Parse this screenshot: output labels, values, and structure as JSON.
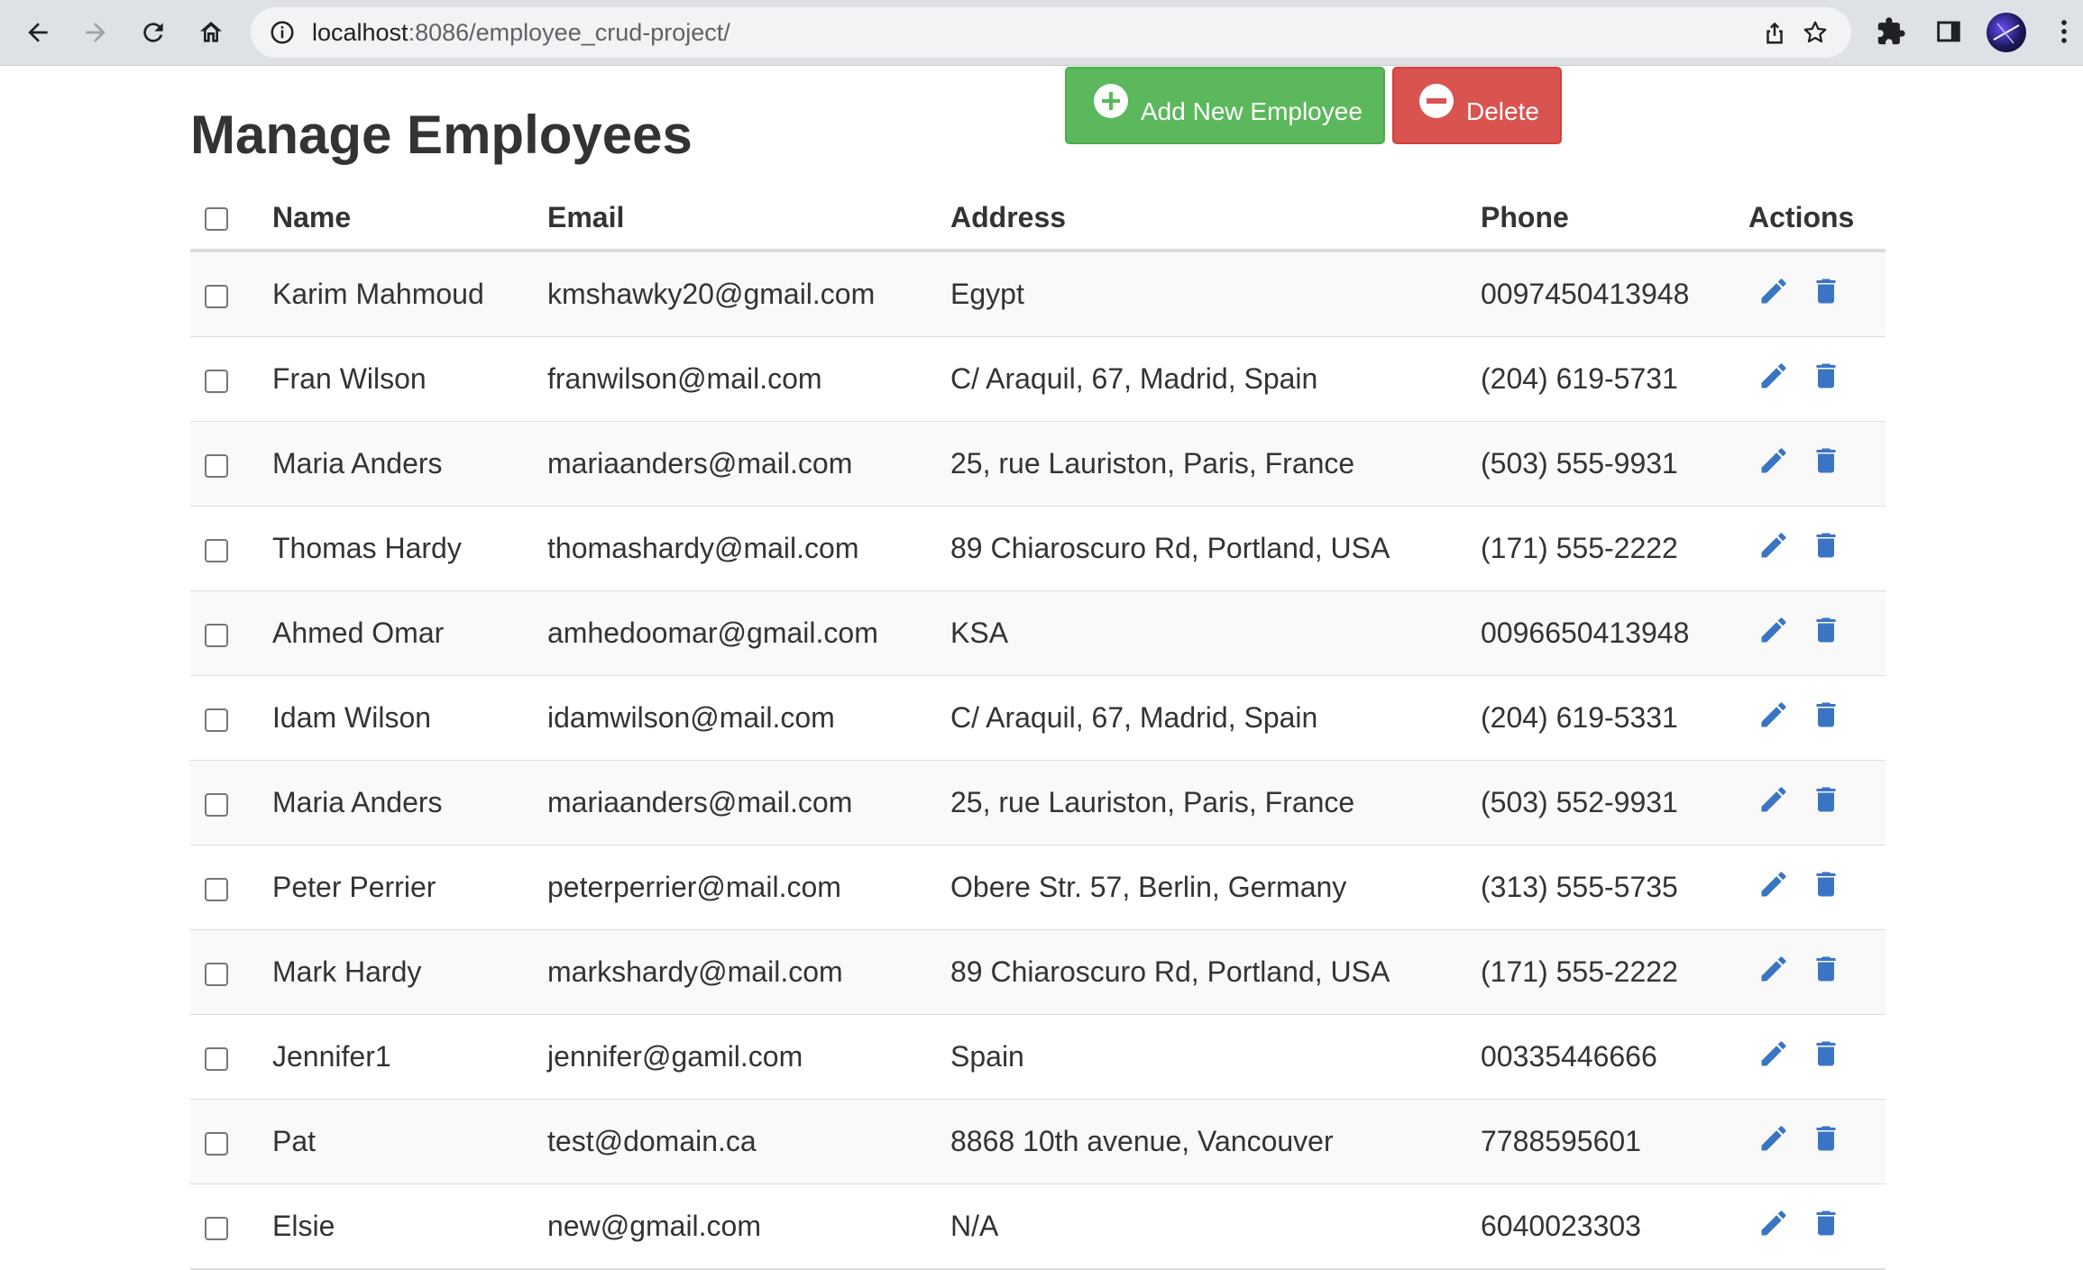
{
  "browser": {
    "url_host": "localhost",
    "url_rest": ":8086/employee_crud-project/"
  },
  "page": {
    "title": "Manage Employees",
    "add_button_label": "Add New Employee",
    "delete_button_label": "Delete"
  },
  "table": {
    "headers": {
      "name": "Name",
      "email": "Email",
      "address": "Address",
      "phone": "Phone",
      "actions": "Actions"
    },
    "rows": [
      {
        "name": "Karim Mahmoud",
        "email": "kmshawky20@gmail.com",
        "address": "Egypt",
        "phone": "0097450413948"
      },
      {
        "name": "Fran Wilson",
        "email": "franwilson@mail.com",
        "address": "C/ Araquil, 67, Madrid, Spain",
        "phone": "(204) 619-5731"
      },
      {
        "name": "Maria Anders",
        "email": "mariaanders@mail.com",
        "address": "25, rue Lauriston, Paris, France",
        "phone": "(503) 555-9931"
      },
      {
        "name": "Thomas Hardy",
        "email": "thomashardy@mail.com",
        "address": "89 Chiaroscuro Rd, Portland, USA",
        "phone": "(171) 555-2222"
      },
      {
        "name": "Ahmed Omar",
        "email": "amhedoomar@gmail.com",
        "address": "KSA",
        "phone": "0096650413948"
      },
      {
        "name": "Idam Wilson",
        "email": "idamwilson@mail.com",
        "address": "C/ Araquil, 67, Madrid, Spain",
        "phone": "(204) 619-5331"
      },
      {
        "name": "Maria Anders",
        "email": "mariaanders@mail.com",
        "address": "25, rue Lauriston, Paris, France",
        "phone": "(503) 552-9931"
      },
      {
        "name": "Peter Perrier",
        "email": "peterperrier@mail.com",
        "address": "Obere Str. 57, Berlin, Germany",
        "phone": "(313) 555-5735"
      },
      {
        "name": "Mark Hardy",
        "email": "markshardy@mail.com",
        "address": "89 Chiaroscuro Rd, Portland, USA",
        "phone": "(171) 555-2222"
      },
      {
        "name": "Jennifer1",
        "email": "jennifer@gamil.com",
        "address": "Spain",
        "phone": "00335446666"
      },
      {
        "name": "Pat",
        "email": "test@domain.ca",
        "address": "8868 10th avenue, Vancouver",
        "phone": "7788595601"
      },
      {
        "name": "Elsie",
        "email": "new@gmail.com",
        "address": "N/A",
        "phone": "6040023303"
      }
    ]
  },
  "icons": {
    "back": "arrow-left-icon",
    "forward": "arrow-right-icon",
    "reload": "reload-icon",
    "home": "home-icon",
    "site_info": "info-icon",
    "share": "share-icon",
    "bookmark": "star-icon",
    "extensions": "puzzle-icon",
    "side_panel": "side-panel-icon",
    "profile": "avatar",
    "menu": "kebab-menu-icon",
    "edit": "pencil-icon",
    "delete": "trash-icon"
  },
  "colors": {
    "add_button": "#5cb85c",
    "delete_button": "#d9534f",
    "action_icon": "#3a75c4",
    "striped_row": "#f9f9f9"
  }
}
